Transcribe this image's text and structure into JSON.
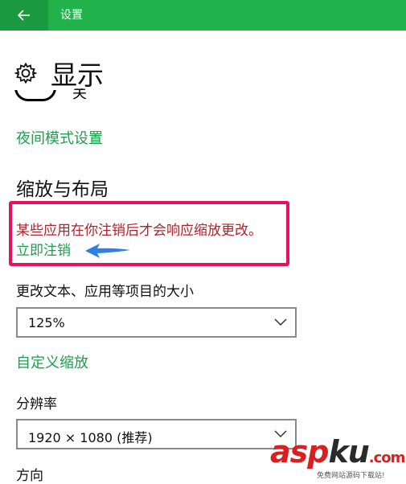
{
  "titlebar": {
    "title": "设置",
    "back_icon": "back-arrow-icon"
  },
  "header": {
    "title": "显示",
    "icon": "gear-icon"
  },
  "night_light": {
    "toggle_state": "关",
    "settings_link": "夜间模式设置"
  },
  "scale_layout": {
    "section_title": "缩放与布局",
    "notice": "某些应用在你注销后才会响应缩放更改。",
    "logout_link": "立即注销",
    "text_size_label": "更改文本、应用等项目的大小",
    "text_size_value": "125%",
    "custom_scaling_link": "自定义缩放",
    "resolution_label": "分辨率",
    "resolution_value": "1920 × 1080 (推荐)",
    "orientation_label": "方向"
  },
  "watermark": {
    "brand_a": "asp",
    "brand_b": "ku",
    "brand_c": ".com",
    "tagline": "免费网站源码下载站!"
  },
  "colors": {
    "titlebar": "#22b24c",
    "accent_link": "#1e9e4c",
    "notice_border": "#e8115e",
    "notice_text": "#b0232b"
  }
}
